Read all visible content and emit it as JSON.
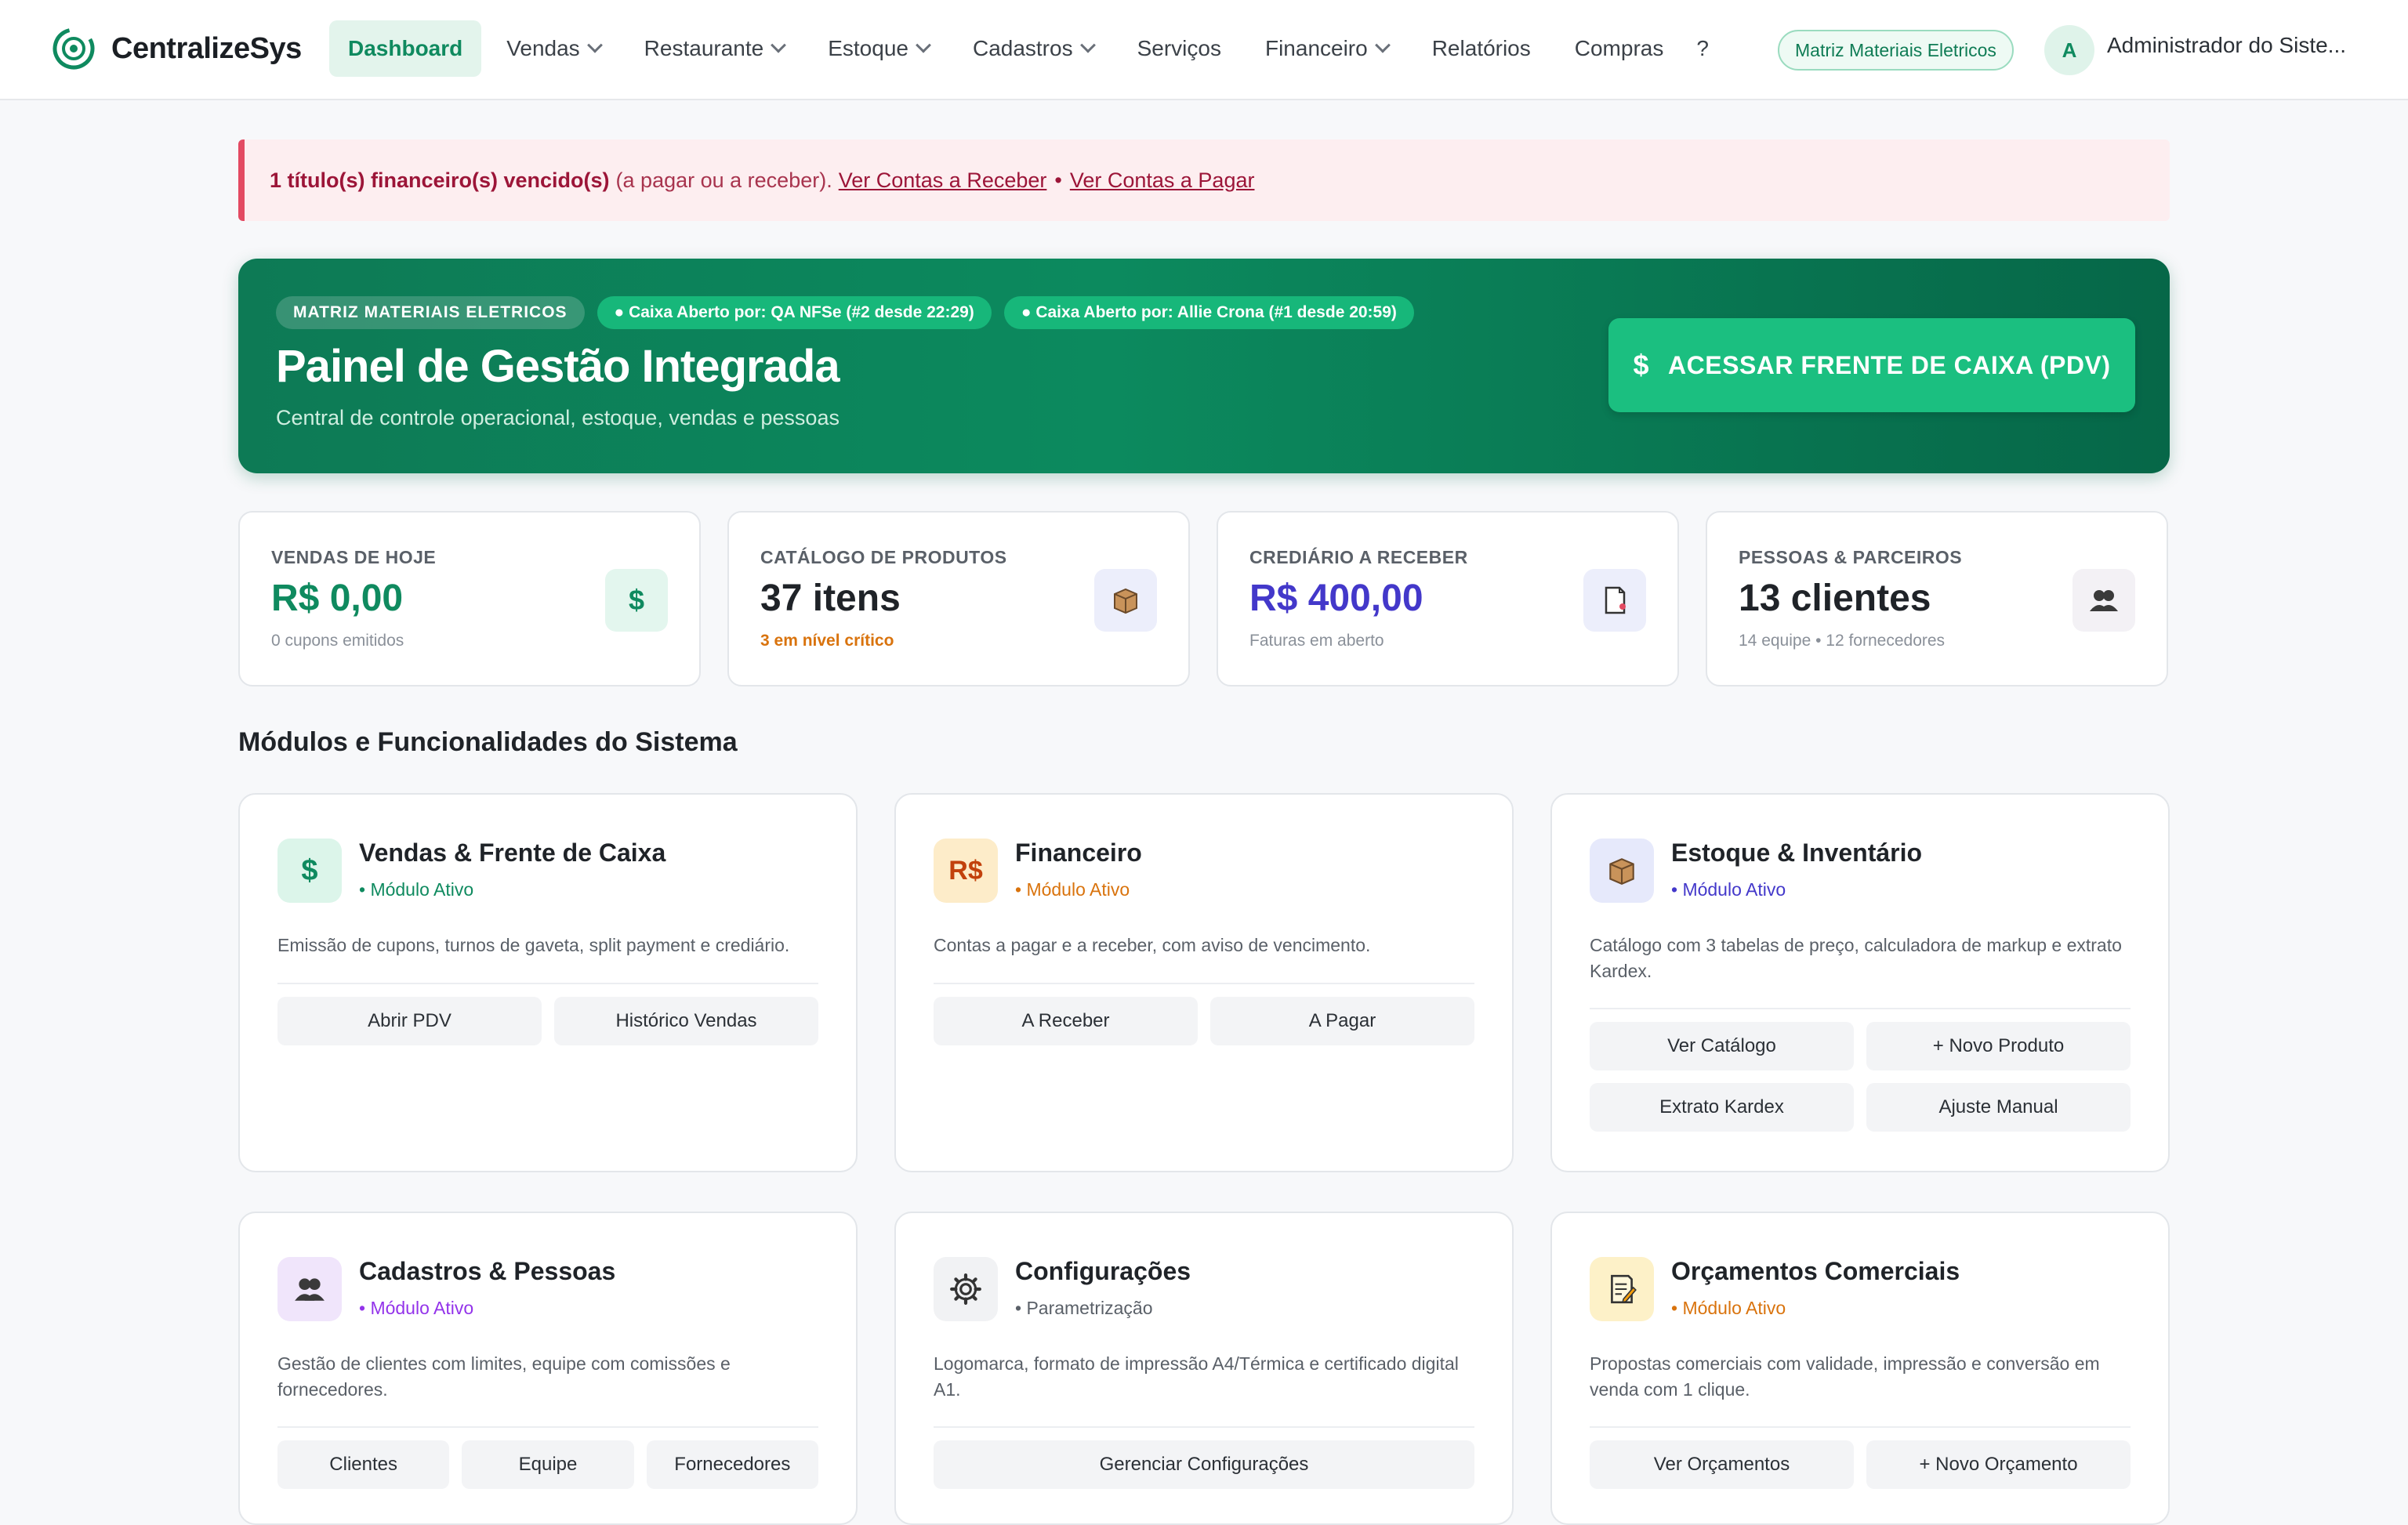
{
  "app": {
    "name": "CentralizeSys"
  },
  "nav": {
    "items": [
      {
        "label": "Dashboard",
        "active": true,
        "dropdown": false
      },
      {
        "label": "Vendas",
        "dropdown": true
      },
      {
        "label": "Restaurante",
        "dropdown": true
      },
      {
        "label": "Estoque",
        "dropdown": true
      },
      {
        "label": "Cadastros",
        "dropdown": true
      },
      {
        "label": "Serviços",
        "dropdown": false
      },
      {
        "label": "Financeiro",
        "dropdown": true
      },
      {
        "label": "Relatórios",
        "dropdown": false
      },
      {
        "label": "Compras",
        "dropdown": false
      }
    ],
    "help": "?",
    "branch": "Matriz Materiais Eletricos",
    "avatar_initial": "A",
    "user": "Administrador do Siste..."
  },
  "alert": {
    "bold": "1 título(s) financeiro(s) vencido(s)",
    "text": "(a pagar ou a receber).",
    "link_receber": "Ver Contas a Receber",
    "separator": "•",
    "link_pagar": "Ver Contas a Pagar"
  },
  "hero": {
    "tag_branch": "MATRIZ MATERIAIS ELETRICOS",
    "tag_caixa1": "● Caixa Aberto por: QA NFSe (#2 desde 22:29)",
    "tag_caixa2": "● Caixa Aberto por: Allie Crona (#1 desde 20:59)",
    "title": "Painel de Gestão Integrada",
    "subtitle": "Central de controle operacional, estoque, vendas e pessoas",
    "pdv_icon": "$",
    "pdv_label": "ACESSAR FRENTE DE CAIXA (PDV)"
  },
  "stats": [
    {
      "label": "VENDAS DE HOJE",
      "value": "R$ 0,00",
      "note": "0 cupons emitidos",
      "icon": "dollar-icon",
      "value_color": "#0f8a5f",
      "note_color": "#8a9099"
    },
    {
      "label": "CATÁLOGO DE PRODUTOS",
      "value": "37 itens",
      "note": "3 em nível crítico",
      "icon": "box-icon",
      "value_color": "#1f2328",
      "note_color": "#d9730d"
    },
    {
      "label": "CREDIÁRIO A RECEBER",
      "value": "R$ 400,00",
      "note": "Faturas em aberto",
      "icon": "invoice-icon",
      "value_color": "#4338ca",
      "note_color": "#8a9099"
    },
    {
      "label": "PESSOAS & PARCEIROS",
      "value": "13 clientes",
      "note": "14 equipe • 12 fornecedores",
      "icon": "people-icon",
      "value_color": "#1f2328",
      "note_color": "#8a9099"
    }
  ],
  "section_title": "Módulos e Funcionalidades do Sistema",
  "modules": [
    {
      "title": "Vendas & Frente de Caixa",
      "status": "• Módulo Ativo",
      "status_color": "#0f8a5f",
      "icon": "dollar-icon",
      "desc": "Emissão de cupons, turnos de gaveta, split payment e crediário.",
      "buttons": [
        "Abrir PDV",
        "Histórico Vendas"
      ]
    },
    {
      "title": "Financeiro",
      "status": "• Módulo Ativo",
      "status_color": "#d9730d",
      "icon": "real-icon",
      "icon_text": "R$",
      "desc": "Contas a pagar e a receber, com aviso de vencimento.",
      "buttons": [
        "A Receber",
        "A Pagar"
      ]
    },
    {
      "title": "Estoque & Inventário",
      "status": "• Módulo Ativo",
      "status_color": "#4338ca",
      "icon": "box-icon",
      "desc": "Catálogo com 3 tabelas de preço, calculadora de markup e extrato Kardex.",
      "buttons": [
        "Ver Catálogo",
        "+ Novo Produto",
        "Extrato Kardex",
        "Ajuste Manual"
      ]
    },
    {
      "title": "Cadastros & Pessoas",
      "status": "• Módulo Ativo",
      "status_color": "#9333ea",
      "icon": "people-icon",
      "desc": "Gestão de clientes com limites, equipe com comissões e fornecedores.",
      "buttons": [
        "Clientes",
        "Equipe",
        "Fornecedores"
      ]
    },
    {
      "title": "Configurações",
      "status": "• Parametrização",
      "status_color": "#5a6068",
      "icon": "gear-icon",
      "desc": "Logomarca, formato de impressão A4/Térmica e certificado digital A1.",
      "buttons": [
        "Gerenciar Configurações"
      ]
    },
    {
      "title": "Orçamentos Comerciais",
      "status": "• Módulo Ativo",
      "status_color": "#d9730d",
      "icon": "memo-icon",
      "desc": "Propostas comerciais com validade, impressão e conversão em venda com 1 clique.",
      "buttons": [
        "Ver Orçamentos",
        "+ Novo Orçamento"
      ]
    }
  ]
}
